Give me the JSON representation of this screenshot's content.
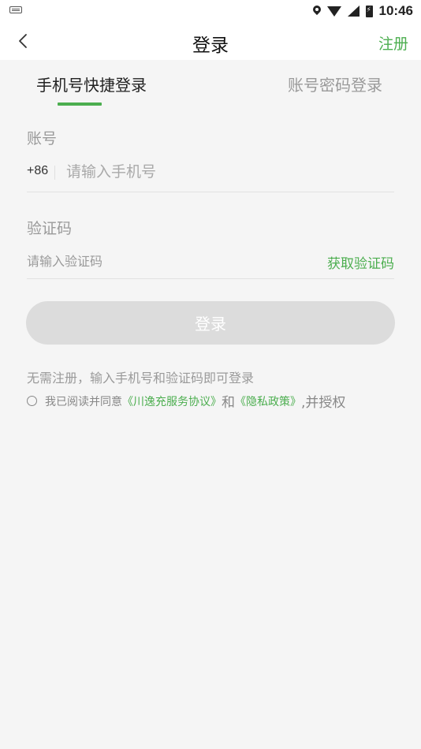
{
  "status_bar": {
    "time": "10:46"
  },
  "header": {
    "title": "登录",
    "register_label": "注册"
  },
  "tabs": [
    {
      "label": "手机号快捷登录",
      "active": true
    },
    {
      "label": "账号密码登录",
      "active": false
    }
  ],
  "account": {
    "label": "账号",
    "country_code": "+86",
    "placeholder": "请输入手机号",
    "value": ""
  },
  "code": {
    "label": "验证码",
    "placeholder": "请输入验证码",
    "value": "",
    "get_code_label": "获取验证码"
  },
  "login_button": {
    "label": "登录"
  },
  "hint": "无需注册，输入手机号和验证码即可登录",
  "agreement": {
    "prefix": "我已阅读并同意",
    "service_link": "《川逸充服务协议》",
    "and": "和",
    "privacy_link": "《隐私政策》",
    "suffix": ",并授权",
    "checked": false
  },
  "colors": {
    "accent": "#4cae4f",
    "button_disabled": "#dcdcdc",
    "background": "#f5f5f5"
  },
  "icons": [
    "keyboard-icon",
    "location-icon",
    "wifi-icon",
    "signal-icon",
    "battery-icon",
    "back-arrow-icon"
  ]
}
